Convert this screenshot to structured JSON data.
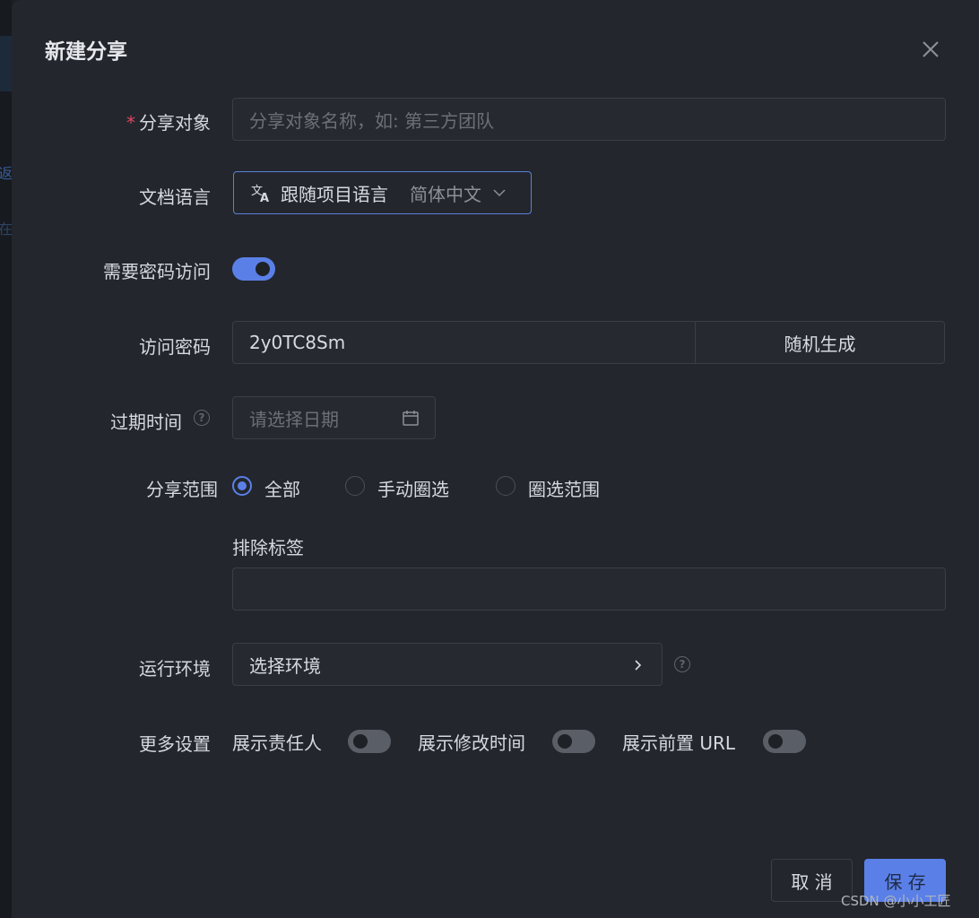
{
  "background": {
    "ghost_chars": [
      "返",
      "在"
    ]
  },
  "dialog": {
    "title": "新建分享",
    "close_icon": "close-icon"
  },
  "form": {
    "share_target": {
      "required_mark": "*",
      "label": "分享对象",
      "placeholder": "分享对象名称，如: 第三方团队",
      "value": ""
    },
    "doc_language": {
      "label": "文档语言",
      "icon": "translate-icon",
      "option_label": "跟随项目语言",
      "option_value": "简体中文"
    },
    "require_password": {
      "label": "需要密码访问",
      "enabled": true
    },
    "access_password": {
      "label": "访问密码",
      "value": "2y0TC8Sm",
      "random_button": "随机生成"
    },
    "expiry": {
      "label": "过期时间",
      "placeholder": "请选择日期",
      "help": "?"
    },
    "share_scope": {
      "label": "分享范围",
      "options": [
        "全部",
        "手动圈选",
        "圈选范围"
      ],
      "selected": "全部"
    },
    "exclude_tags": {
      "label": "排除标签",
      "value": ""
    },
    "run_env": {
      "label": "运行环境",
      "value": "选择环境",
      "help": "?"
    },
    "more_settings": {
      "label": "更多设置",
      "options": [
        {
          "label": "展示责任人",
          "enabled": false
        },
        {
          "label": "展示修改时间",
          "enabled": false
        },
        {
          "label": "展示前置 URL",
          "enabled": false
        }
      ]
    }
  },
  "footer": {
    "cancel": "取 消",
    "save": "保 存"
  },
  "colors": {
    "accent": "#5a80e8",
    "dialog_bg": "#23262d",
    "required": "#e0475f"
  },
  "watermark": "CSDN @小小工匠"
}
